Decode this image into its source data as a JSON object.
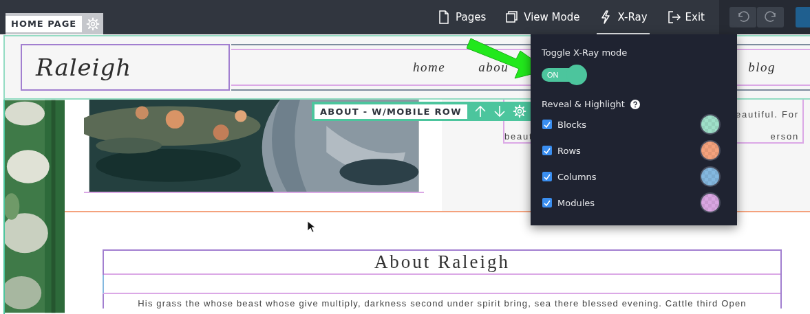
{
  "top_bar": {
    "nav_items": [
      {
        "label": "Pages",
        "selected": false
      },
      {
        "label": "View Mode",
        "selected": false
      },
      {
        "label": "X-Ray",
        "selected": true
      },
      {
        "label": "Exit",
        "selected": false
      }
    ]
  },
  "page_tag": {
    "label": "HOME PAGE"
  },
  "site_header": {
    "logo": "Raleigh",
    "menu": [
      {
        "label": "home"
      },
      {
        "label": "abou"
      },
      {
        "label": "blog"
      }
    ]
  },
  "row_toolbar": {
    "label": "ABOUT - W/MOBILE ROW"
  },
  "side_text": {
    "lines": [
      {
        "right": "eautiful. For"
      },
      {
        "left": "beaut",
        "right": "erson"
      }
    ]
  },
  "about_section": {
    "heading": "About Raleigh",
    "paragraph": "His grass the whose beast whose give multiply, darkness second under spirit bring, sea there blessed evening. Cattle third Open"
  },
  "xray_panel": {
    "toggle_label": "Toggle X-Ray mode",
    "toggle": {
      "on": true,
      "text": "ON"
    },
    "reveal_label": "Reveal & Highlight",
    "options": [
      {
        "label": "Blocks",
        "checked": true,
        "color": "#9fe0c9"
      },
      {
        "label": "Rows",
        "checked": true,
        "color": "#f4a27d"
      },
      {
        "label": "Columns",
        "checked": true,
        "color": "#84b8e0"
      },
      {
        "label": "Modules",
        "checked": true,
        "color": "#d9a6e2"
      }
    ]
  }
}
